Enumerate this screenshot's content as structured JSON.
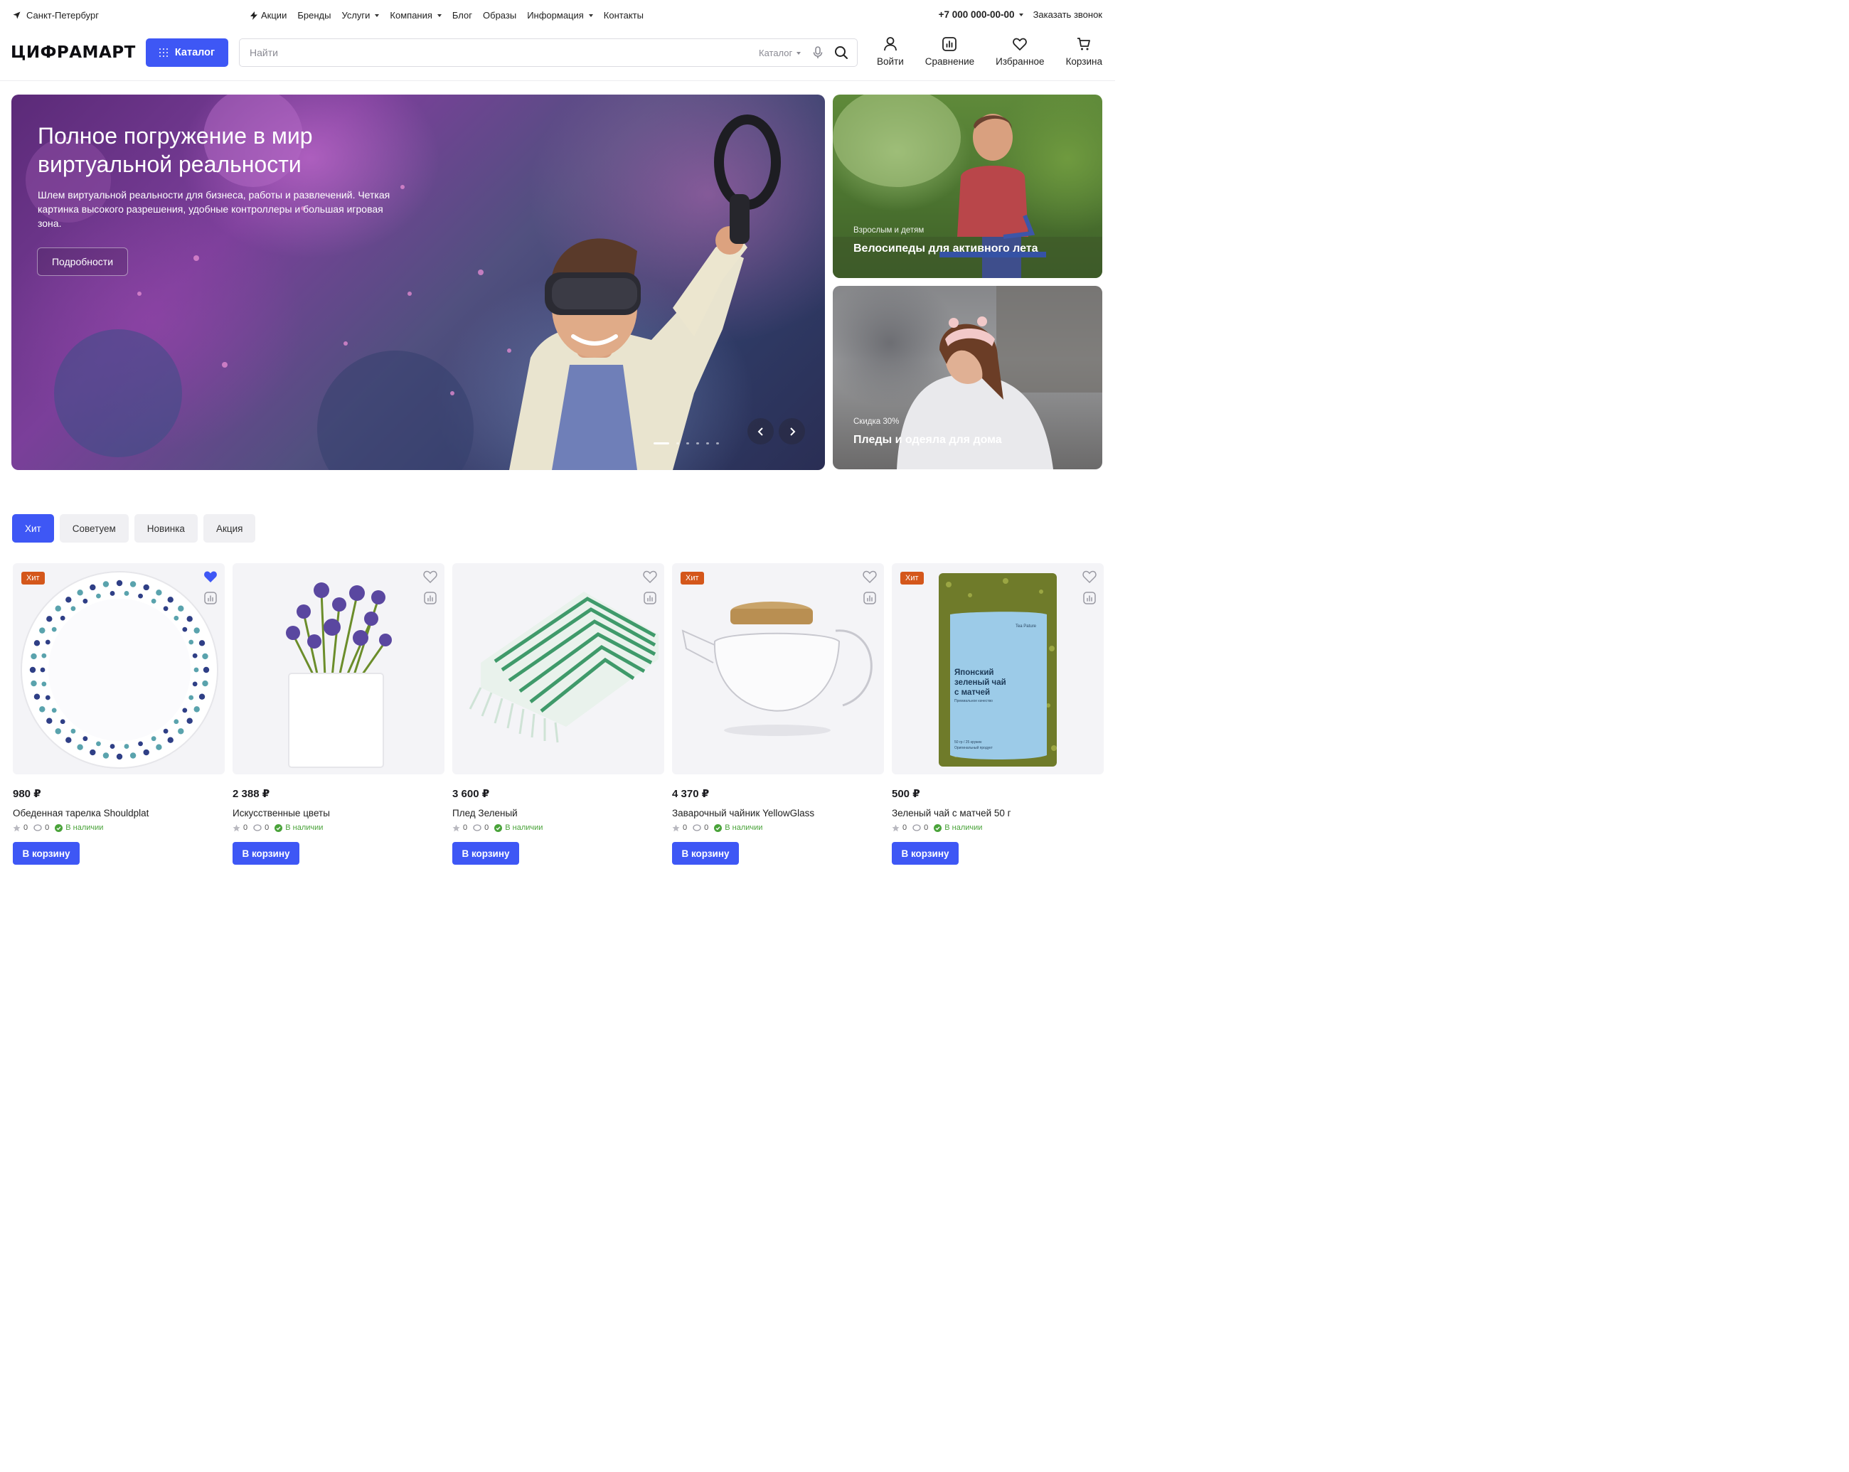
{
  "topbar": {
    "city": "Санкт-Петербург",
    "nav": [
      {
        "label": "Акции",
        "icon": "bolt-icon",
        "dropdown": false
      },
      {
        "label": "Бренды",
        "dropdown": false
      },
      {
        "label": "Услуги",
        "dropdown": true
      },
      {
        "label": "Компания",
        "dropdown": true
      },
      {
        "label": "Блог",
        "dropdown": false
      },
      {
        "label": "Образы",
        "dropdown": false
      },
      {
        "label": "Информация",
        "dropdown": true
      },
      {
        "label": "Контакты",
        "dropdown": false
      }
    ],
    "phone": "+7 000 000-00-00",
    "callback": "Заказать звонок"
  },
  "header": {
    "logo": "ЦИФРАМАРТ",
    "catalog_button": "Каталог",
    "search": {
      "placeholder": "Найти",
      "scope": "Каталог"
    },
    "actions": [
      {
        "label": "Войти",
        "icon": "user-icon"
      },
      {
        "label": "Сравнение",
        "icon": "compare-icon"
      },
      {
        "label": "Избранное",
        "icon": "heart-icon"
      },
      {
        "label": "Корзина",
        "icon": "cart-icon"
      }
    ],
    "accent": "#3e57f5"
  },
  "hero": {
    "title": "Полное погружение в мир виртуальной реальности",
    "text": "Шлем виртуальной реальности для бизнеса, работы и развлечений. Четкая картинка высокого разрешения, удобные контроллеры и большая игровая зона.",
    "button": "Подробности",
    "slides": 6,
    "active_slide": 1
  },
  "side_banners": [
    {
      "subtitle": "Взрослым и детям",
      "title": "Велосипеды для активного лета"
    },
    {
      "subtitle": "Скидка 30%",
      "title": "Пледы и одеяла для дома"
    }
  ],
  "tabs": [
    {
      "label": "Хит",
      "active": true
    },
    {
      "label": "Советуем",
      "active": false
    },
    {
      "label": "Новинка",
      "active": false
    },
    {
      "label": "Акция",
      "active": false
    }
  ],
  "products": [
    {
      "price": "980 ₽",
      "name": "Обеденная тарелка Shouldplat",
      "badge": "Хит",
      "favorite": true,
      "rating": "0",
      "reviews": "0",
      "stock": "В наличии",
      "button": "В корзину"
    },
    {
      "price": "2 388 ₽",
      "name": "Искусственные цветы",
      "badge": "",
      "favorite": false,
      "rating": "0",
      "reviews": "0",
      "stock": "В наличии",
      "button": "В корзину"
    },
    {
      "price": "3 600 ₽",
      "name": "Плед Зеленый",
      "badge": "",
      "favorite": false,
      "rating": "0",
      "reviews": "0",
      "stock": "В наличии",
      "button": "В корзину"
    },
    {
      "price": "4 370 ₽",
      "name": "Заварочный чайник YellowGlass",
      "badge": "Хит",
      "favorite": false,
      "rating": "0",
      "reviews": "0",
      "stock": "В наличии",
      "button": "В корзину"
    },
    {
      "price": "500 ₽",
      "name": "Зеленый чай с матчей 50 г",
      "badge": "Хит",
      "favorite": false,
      "rating": "0",
      "reviews": "0",
      "stock": "В наличии",
      "button": "В корзину",
      "package_text": {
        "brand": "Tea Pature",
        "title": "Японский зеленый чай с матчей",
        "tagline": "Премиальное качество",
        "weight": "50 гр / 25 кружек",
        "note": "Оригинальный продукт"
      }
    }
  ],
  "colors": {
    "badge": "#d4571b",
    "stock": "#4aa33a",
    "favorite_active": "#3e57f5"
  }
}
